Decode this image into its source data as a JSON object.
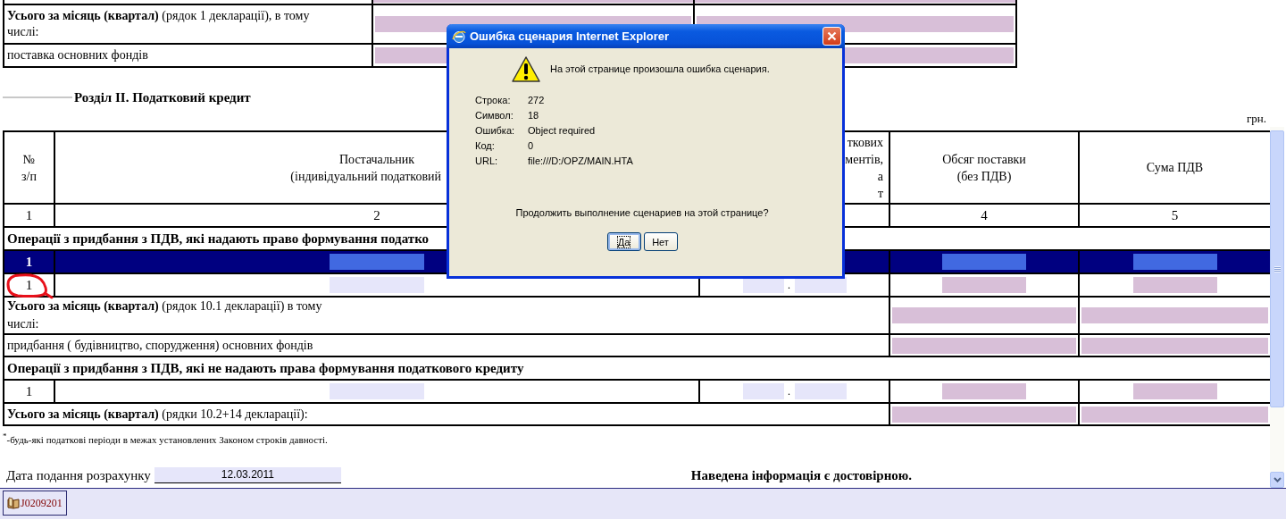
{
  "top_table": {
    "rows": [
      {
        "kind": "cut",
        "fields": [
          {
            "kind": "computed"
          },
          {
            "kind": "computed"
          }
        ]
      },
      {
        "kind": "total",
        "label": "**Усього за місяць (квартал)** (рядок 1 декларації), в тому числі:",
        "fields": [
          {
            "kind": "computed"
          },
          {
            "kind": "computed"
          }
        ]
      },
      {
        "kind": "total",
        "label": "поставка основних фондів",
        "fields": [
          {
            "kind": "computed"
          },
          {
            "kind": "computed"
          }
        ]
      }
    ]
  },
  "section_title": "Розділ ІІ. Податковий кредит",
  "currency": "грн.",
  "credit_table": {
    "columns": [
      {
        "lines": [
          "№",
          "з/п"
        ],
        "number": "1"
      },
      {
        "lines": [
          "Постачальник",
          "(індивідуальний податковий"
        ],
        "number": "2"
      },
      {
        "lines": [
          "ткових",
          "ментів,",
          "а",
          "т"
        ]
      },
      {
        "lines": [
          "Обсяг поставки",
          "(без ПДВ)"
        ],
        "number": "4"
      },
      {
        "lines": [
          "Сума ПДВ"
        ],
        "number": "5"
      }
    ],
    "rows": [
      {
        "kind": "section",
        "text": "Операції з придбання з ПДВ, які надають право формування податко"
      },
      {
        "kind": "entry",
        "number": "1",
        "selected": true,
        "cells": [
          {
            "kind": "field",
            "fields": [
              {
                "kind": "active"
              }
            ]
          },
          {
            "kind": "plain"
          },
          {
            "kind": "field",
            "fields": [
              {
                "kind": "active"
              }
            ]
          },
          {
            "kind": "field",
            "fields": [
              {
                "kind": "active"
              }
            ]
          }
        ]
      },
      {
        "kind": "entry",
        "number": "1",
        "selected": false,
        "cells": [
          {
            "kind": "field",
            "fields": [
              {
                "kind": "input"
              }
            ]
          },
          {
            "kind": "date",
            "fields": [
              {
                "kind": "input"
              },
              {
                "kind": "input"
              }
            ],
            "separator": "."
          },
          {
            "kind": "field",
            "fields": [
              {
                "kind": "computed"
              }
            ]
          },
          {
            "kind": "field",
            "fields": [
              {
                "kind": "computed"
              }
            ]
          }
        ]
      },
      {
        "kind": "total",
        "label": "**Усього за місяць (квартал)** (рядок 10.1 декларації) в тому числі:",
        "fields": [
          {
            "kind": "computed"
          },
          {
            "kind": "computed"
          }
        ]
      },
      {
        "kind": "total",
        "label": "придбання ( будівництво, спорудження) основних фондів",
        "fields": [
          {
            "kind": "computed"
          },
          {
            "kind": "computed"
          }
        ]
      },
      {
        "kind": "section",
        "text": "Операції з придбання з ПДВ, які не надають права формування податкового кредиту"
      },
      {
        "kind": "entry",
        "number": "1",
        "selected": false,
        "cells": [
          {
            "kind": "field",
            "fields": [
              {
                "kind": "input"
              }
            ]
          },
          {
            "kind": "date",
            "fields": [
              {
                "kind": "input"
              },
              {
                "kind": "input"
              }
            ],
            "separator": "."
          },
          {
            "kind": "field",
            "fields": [
              {
                "kind": "computed"
              }
            ]
          },
          {
            "kind": "field",
            "fields": [
              {
                "kind": "computed"
              }
            ]
          }
        ]
      },
      {
        "kind": "total",
        "label": "**Усього за місяць (квартал)** (рядки 10.2+14 декларації):",
        "fields": [
          {
            "kind": "computed"
          },
          {
            "kind": "computed"
          }
        ]
      }
    ]
  },
  "footnote": "$^{*}$-будь-які податкові періоди в межах установлених Законом строків давності.",
  "date_field": {
    "label": "Дата подання розрахунку",
    "value": "12.03.2011"
  },
  "confirmation": "Наведена інформація є достовірною.",
  "dialog": {
    "title": "Ошибка сценария Internet Explorer",
    "message": "На этой странице произошла ошибка сценария.",
    "details": [
      {
        "label": "Строка:",
        "value": "272"
      },
      {
        "label": "Символ:",
        "value": "18"
      },
      {
        "label": "Ошибка:",
        "value": "Object required"
      },
      {
        "label": "Код:",
        "value": "0"
      },
      {
        "label": "URL:",
        "value": "file:///D:/OPZ/MAIN.HTA"
      }
    ],
    "question": "Продолжить выполнение сценариев на этой странице?",
    "buttons": [
      {
        "label": "Да",
        "focused": true
      },
      {
        "label": "Нет",
        "focused": false
      }
    ]
  },
  "taskbar": {
    "tabs": [
      {
        "label": "J0209201"
      }
    ]
  }
}
